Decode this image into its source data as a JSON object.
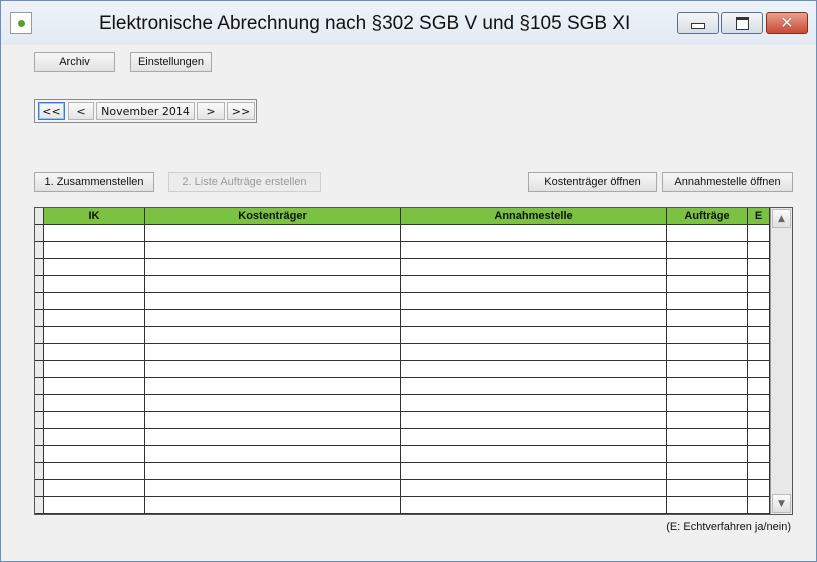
{
  "window": {
    "title": "Elektronische Abrechnung nach §302 SGB V und §105 SGB XI",
    "close_glyph": "✕"
  },
  "toolbar": {
    "archive_label": "Archiv",
    "settings_label": "Einstellungen"
  },
  "period_nav": {
    "first_label": "<<",
    "prev_label": "<",
    "current": "November 2014",
    "next_label": ">",
    "last_label": ">>"
  },
  "actions": {
    "compile_label": "1. Zusammenstellen",
    "create_list_label": "2. Liste Aufträge erstellen",
    "open_payer_label": "Kostenträger öffnen",
    "open_acceptance_label": "Annahmestelle öffnen"
  },
  "table": {
    "columns": [
      "IK",
      "Kostenträger",
      "Annahmestelle",
      "Aufträge",
      "E"
    ],
    "rows": [
      [
        "",
        "",
        "",
        "",
        ""
      ],
      [
        "",
        "",
        "",
        "",
        ""
      ],
      [
        "",
        "",
        "",
        "",
        ""
      ],
      [
        "",
        "",
        "",
        "",
        ""
      ],
      [
        "",
        "",
        "",
        "",
        ""
      ],
      [
        "",
        "",
        "",
        "",
        ""
      ],
      [
        "",
        "",
        "",
        "",
        ""
      ],
      [
        "",
        "",
        "",
        "",
        ""
      ],
      [
        "",
        "",
        "",
        "",
        ""
      ],
      [
        "",
        "",
        "",
        "",
        ""
      ],
      [
        "",
        "",
        "",
        "",
        ""
      ],
      [
        "",
        "",
        "",
        "",
        ""
      ],
      [
        "",
        "",
        "",
        "",
        ""
      ],
      [
        "",
        "",
        "",
        "",
        ""
      ],
      [
        "",
        "",
        "",
        "",
        ""
      ],
      [
        "",
        "",
        "",
        "",
        ""
      ],
      [
        "",
        "",
        "",
        "",
        ""
      ]
    ],
    "header_color": "#7bc142"
  },
  "footnote": "(E: Echtverfahren ja/nein)"
}
